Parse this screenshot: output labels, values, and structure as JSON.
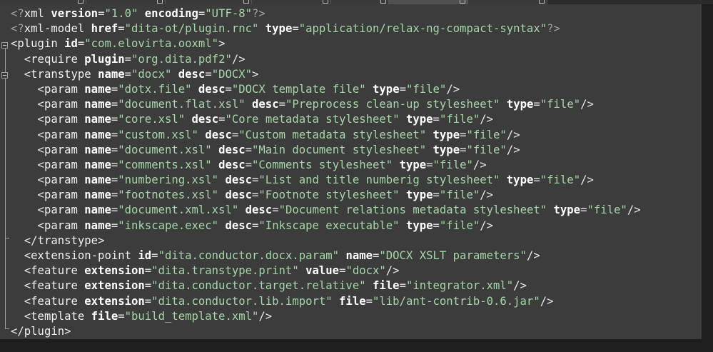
{
  "editor": {
    "language": "xml",
    "colors": {
      "background": "#3c3c3c",
      "text": "#e6e6e6",
      "attribute": "#ffffff",
      "value": "#a5d6a7",
      "processing_instruction": "#9aa0a6"
    },
    "lines": [
      [
        [
          "pi",
          "<?"
        ],
        [
          "tag",
          "xml"
        ],
        [
          "t",
          " "
        ],
        [
          "attr",
          "version"
        ],
        [
          "t",
          "="
        ],
        [
          "value",
          "\"1.0\""
        ],
        [
          "t",
          " "
        ],
        [
          "attr",
          "encoding"
        ],
        [
          "t",
          "="
        ],
        [
          "value",
          "\"UTF-8\""
        ],
        [
          "pi",
          "?>"
        ]
      ],
      [
        [
          "pi",
          "<?"
        ],
        [
          "tag",
          "xml-model"
        ],
        [
          "t",
          " "
        ],
        [
          "attr",
          "href"
        ],
        [
          "t",
          "="
        ],
        [
          "value",
          "\"dita-ot/plugin.rnc\""
        ],
        [
          "t",
          " "
        ],
        [
          "attr",
          "type"
        ],
        [
          "t",
          "="
        ],
        [
          "value",
          "\"application/relax-ng-compact-syntax\""
        ],
        [
          "pi",
          "?>"
        ]
      ],
      [
        [
          "t",
          "<"
        ],
        [
          "tag",
          "plugin"
        ],
        [
          "t",
          " "
        ],
        [
          "attr",
          "id"
        ],
        [
          "t",
          "="
        ],
        [
          "value",
          "\"com.elovirta.ooxml\""
        ],
        [
          "t",
          ">"
        ]
      ],
      [
        [
          "t",
          "  <"
        ],
        [
          "tag",
          "require"
        ],
        [
          "t",
          " "
        ],
        [
          "attr",
          "plugin"
        ],
        [
          "t",
          "="
        ],
        [
          "value",
          "\"org.dita.pdf2\""
        ],
        [
          "t",
          "/>"
        ]
      ],
      [
        [
          "t",
          "  <"
        ],
        [
          "tag",
          "transtype"
        ],
        [
          "t",
          " "
        ],
        [
          "attr",
          "name"
        ],
        [
          "t",
          "="
        ],
        [
          "value",
          "\"docx\""
        ],
        [
          "t",
          " "
        ],
        [
          "attr",
          "desc"
        ],
        [
          "t",
          "="
        ],
        [
          "value",
          "\"DOCX\""
        ],
        [
          "t",
          ">"
        ]
      ],
      [
        [
          "t",
          "    <"
        ],
        [
          "tag",
          "param"
        ],
        [
          "t",
          " "
        ],
        [
          "attr",
          "name"
        ],
        [
          "t",
          "="
        ],
        [
          "value",
          "\"dotx.file\""
        ],
        [
          "t",
          " "
        ],
        [
          "attr",
          "desc"
        ],
        [
          "t",
          "="
        ],
        [
          "value",
          "\"DOCX template file\""
        ],
        [
          "t",
          " "
        ],
        [
          "attr",
          "type"
        ],
        [
          "t",
          "="
        ],
        [
          "value",
          "\"file\""
        ],
        [
          "t",
          "/>"
        ]
      ],
      [
        [
          "t",
          "    <"
        ],
        [
          "tag",
          "param"
        ],
        [
          "t",
          " "
        ],
        [
          "attr",
          "name"
        ],
        [
          "t",
          "="
        ],
        [
          "value",
          "\"document.flat.xsl\""
        ],
        [
          "t",
          " "
        ],
        [
          "attr",
          "desc"
        ],
        [
          "t",
          "="
        ],
        [
          "value",
          "\"Preprocess clean-up stylesheet\""
        ],
        [
          "t",
          " "
        ],
        [
          "attr",
          "type"
        ],
        [
          "t",
          "="
        ],
        [
          "value",
          "\"file\""
        ],
        [
          "t",
          "/>"
        ]
      ],
      [
        [
          "t",
          "    <"
        ],
        [
          "tag",
          "param"
        ],
        [
          "t",
          " "
        ],
        [
          "attr",
          "name"
        ],
        [
          "t",
          "="
        ],
        [
          "value",
          "\"core.xsl\""
        ],
        [
          "t",
          " "
        ],
        [
          "attr",
          "desc"
        ],
        [
          "t",
          "="
        ],
        [
          "value",
          "\"Core metadata stylesheet\""
        ],
        [
          "t",
          " "
        ],
        [
          "attr",
          "type"
        ],
        [
          "t",
          "="
        ],
        [
          "value",
          "\"file\""
        ],
        [
          "t",
          "/>"
        ]
      ],
      [
        [
          "t",
          "    <"
        ],
        [
          "tag",
          "param"
        ],
        [
          "t",
          " "
        ],
        [
          "attr",
          "name"
        ],
        [
          "t",
          "="
        ],
        [
          "value",
          "\"custom.xsl\""
        ],
        [
          "t",
          " "
        ],
        [
          "attr",
          "desc"
        ],
        [
          "t",
          "="
        ],
        [
          "value",
          "\"Custom metadata stylesheet\""
        ],
        [
          "t",
          " "
        ],
        [
          "attr",
          "type"
        ],
        [
          "t",
          "="
        ],
        [
          "value",
          "\"file\""
        ],
        [
          "t",
          "/>"
        ]
      ],
      [
        [
          "t",
          "    <"
        ],
        [
          "tag",
          "param"
        ],
        [
          "t",
          " "
        ],
        [
          "attr",
          "name"
        ],
        [
          "t",
          "="
        ],
        [
          "value",
          "\"document.xsl\""
        ],
        [
          "t",
          " "
        ],
        [
          "attr",
          "desc"
        ],
        [
          "t",
          "="
        ],
        [
          "value",
          "\"Main document stylesheet\""
        ],
        [
          "t",
          " "
        ],
        [
          "attr",
          "type"
        ],
        [
          "t",
          "="
        ],
        [
          "value",
          "\"file\""
        ],
        [
          "t",
          "/>"
        ]
      ],
      [
        [
          "t",
          "    <"
        ],
        [
          "tag",
          "param"
        ],
        [
          "t",
          " "
        ],
        [
          "attr",
          "name"
        ],
        [
          "t",
          "="
        ],
        [
          "value",
          "\"comments.xsl\""
        ],
        [
          "t",
          " "
        ],
        [
          "attr",
          "desc"
        ],
        [
          "t",
          "="
        ],
        [
          "value",
          "\"Comments stylesheet\""
        ],
        [
          "t",
          " "
        ],
        [
          "attr",
          "type"
        ],
        [
          "t",
          "="
        ],
        [
          "value",
          "\"file\""
        ],
        [
          "t",
          "/>"
        ]
      ],
      [
        [
          "t",
          "    <"
        ],
        [
          "tag",
          "param"
        ],
        [
          "t",
          " "
        ],
        [
          "attr",
          "name"
        ],
        [
          "t",
          "="
        ],
        [
          "value",
          "\"numbering.xsl\""
        ],
        [
          "t",
          " "
        ],
        [
          "attr",
          "desc"
        ],
        [
          "t",
          "="
        ],
        [
          "value",
          "\"List and title numberig stylesheet\""
        ],
        [
          "t",
          " "
        ],
        [
          "attr",
          "type"
        ],
        [
          "t",
          "="
        ],
        [
          "value",
          "\"file\""
        ],
        [
          "t",
          "/>"
        ]
      ],
      [
        [
          "t",
          "    <"
        ],
        [
          "tag",
          "param"
        ],
        [
          "t",
          " "
        ],
        [
          "attr",
          "name"
        ],
        [
          "t",
          "="
        ],
        [
          "value",
          "\"footnotes.xsl\""
        ],
        [
          "t",
          " "
        ],
        [
          "attr",
          "desc"
        ],
        [
          "t",
          "="
        ],
        [
          "value",
          "\"Footnote stylesheet\""
        ],
        [
          "t",
          " "
        ],
        [
          "attr",
          "type"
        ],
        [
          "t",
          "="
        ],
        [
          "value",
          "\"file\""
        ],
        [
          "t",
          "/>"
        ]
      ],
      [
        [
          "t",
          "    <"
        ],
        [
          "tag",
          "param"
        ],
        [
          "t",
          " "
        ],
        [
          "attr",
          "name"
        ],
        [
          "t",
          "="
        ],
        [
          "value",
          "\"document.xml.xsl\""
        ],
        [
          "t",
          " "
        ],
        [
          "attr",
          "desc"
        ],
        [
          "t",
          "="
        ],
        [
          "value",
          "\"Document relations metadata stylesheet\""
        ],
        [
          "t",
          " "
        ],
        [
          "attr",
          "type"
        ],
        [
          "t",
          "="
        ],
        [
          "value",
          "\"file\""
        ],
        [
          "t",
          "/>"
        ]
      ],
      [
        [
          "t",
          "    <"
        ],
        [
          "tag",
          "param"
        ],
        [
          "t",
          " "
        ],
        [
          "attr",
          "name"
        ],
        [
          "t",
          "="
        ],
        [
          "value",
          "\"inkscape.exec\""
        ],
        [
          "t",
          " "
        ],
        [
          "attr",
          "desc"
        ],
        [
          "t",
          "="
        ],
        [
          "value",
          "\"Inkscape executable\""
        ],
        [
          "t",
          " "
        ],
        [
          "attr",
          "type"
        ],
        [
          "t",
          "="
        ],
        [
          "value",
          "\"file\""
        ],
        [
          "t",
          "/>"
        ]
      ],
      [
        [
          "t",
          "  </"
        ],
        [
          "tag",
          "transtype"
        ],
        [
          "t",
          ">"
        ]
      ],
      [
        [
          "t",
          "  <"
        ],
        [
          "tag",
          "extension-point"
        ],
        [
          "t",
          " "
        ],
        [
          "attr",
          "id"
        ],
        [
          "t",
          "="
        ],
        [
          "value",
          "\"dita.conductor.docx.param\""
        ],
        [
          "t",
          " "
        ],
        [
          "attr",
          "name"
        ],
        [
          "t",
          "="
        ],
        [
          "value",
          "\"DOCX XSLT parameters\""
        ],
        [
          "t",
          "/>"
        ]
      ],
      [
        [
          "t",
          "  <"
        ],
        [
          "tag",
          "feature"
        ],
        [
          "t",
          " "
        ],
        [
          "attr",
          "extension"
        ],
        [
          "t",
          "="
        ],
        [
          "value",
          "\"dita.transtype.print\""
        ],
        [
          "t",
          " "
        ],
        [
          "attr",
          "value"
        ],
        [
          "t",
          "="
        ],
        [
          "value",
          "\"docx\""
        ],
        [
          "t",
          "/>"
        ]
      ],
      [
        [
          "t",
          "  <"
        ],
        [
          "tag",
          "feature"
        ],
        [
          "t",
          " "
        ],
        [
          "attr",
          "extension"
        ],
        [
          "t",
          "="
        ],
        [
          "value",
          "\"dita.conductor.target.relative\""
        ],
        [
          "t",
          " "
        ],
        [
          "attr",
          "file"
        ],
        [
          "t",
          "="
        ],
        [
          "value",
          "\"integrator.xml\""
        ],
        [
          "t",
          "/>"
        ]
      ],
      [
        [
          "t",
          "  <"
        ],
        [
          "tag",
          "feature"
        ],
        [
          "t",
          " "
        ],
        [
          "attr",
          "extension"
        ],
        [
          "t",
          "="
        ],
        [
          "value",
          "\"dita.conductor.lib.import\""
        ],
        [
          "t",
          " "
        ],
        [
          "attr",
          "file"
        ],
        [
          "t",
          "="
        ],
        [
          "value",
          "\"lib/ant-contrib-0.6.jar\""
        ],
        [
          "t",
          "/>"
        ]
      ],
      [
        [
          "t",
          "  <"
        ],
        [
          "tag",
          "template"
        ],
        [
          "t",
          " "
        ],
        [
          "attr",
          "file"
        ],
        [
          "t",
          "="
        ],
        [
          "value",
          "\"build_template.xml\""
        ],
        [
          "t",
          "/>"
        ]
      ],
      [
        [
          "t",
          "</"
        ],
        [
          "tag",
          "plugin"
        ],
        [
          "t",
          ">"
        ]
      ]
    ]
  }
}
